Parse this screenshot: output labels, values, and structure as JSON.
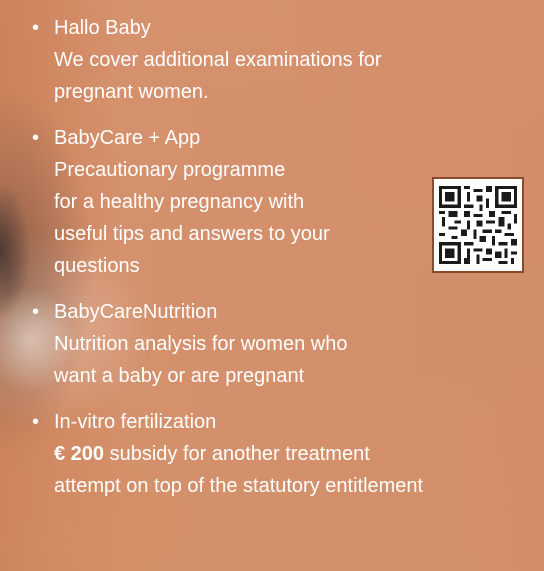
{
  "items": [
    {
      "title": "Hallo Baby",
      "lines": [
        "We cover additional examinations for",
        "pregnant women."
      ]
    },
    {
      "title": "BabyCare + App",
      "lines": [
        "Precautionary programme",
        "for a healthy pregnancy with",
        "useful tips and answers to your",
        "questions"
      ]
    },
    {
      "title": "BabyCareNutrition",
      "lines": [
        "Nutrition analysis for women who",
        "want a baby or are pregnant"
      ]
    },
    {
      "title": "In-vitro fertilization",
      "amount": "€ 200",
      "amount_suffix": " subsidy for another treatment",
      "lines": [
        "attempt on top of the statutory entitlement"
      ]
    }
  ],
  "bullet": "•",
  "colors": {
    "text": "#ffffff",
    "background": "#d38f6b",
    "qr_border": "#8a4a2c"
  }
}
